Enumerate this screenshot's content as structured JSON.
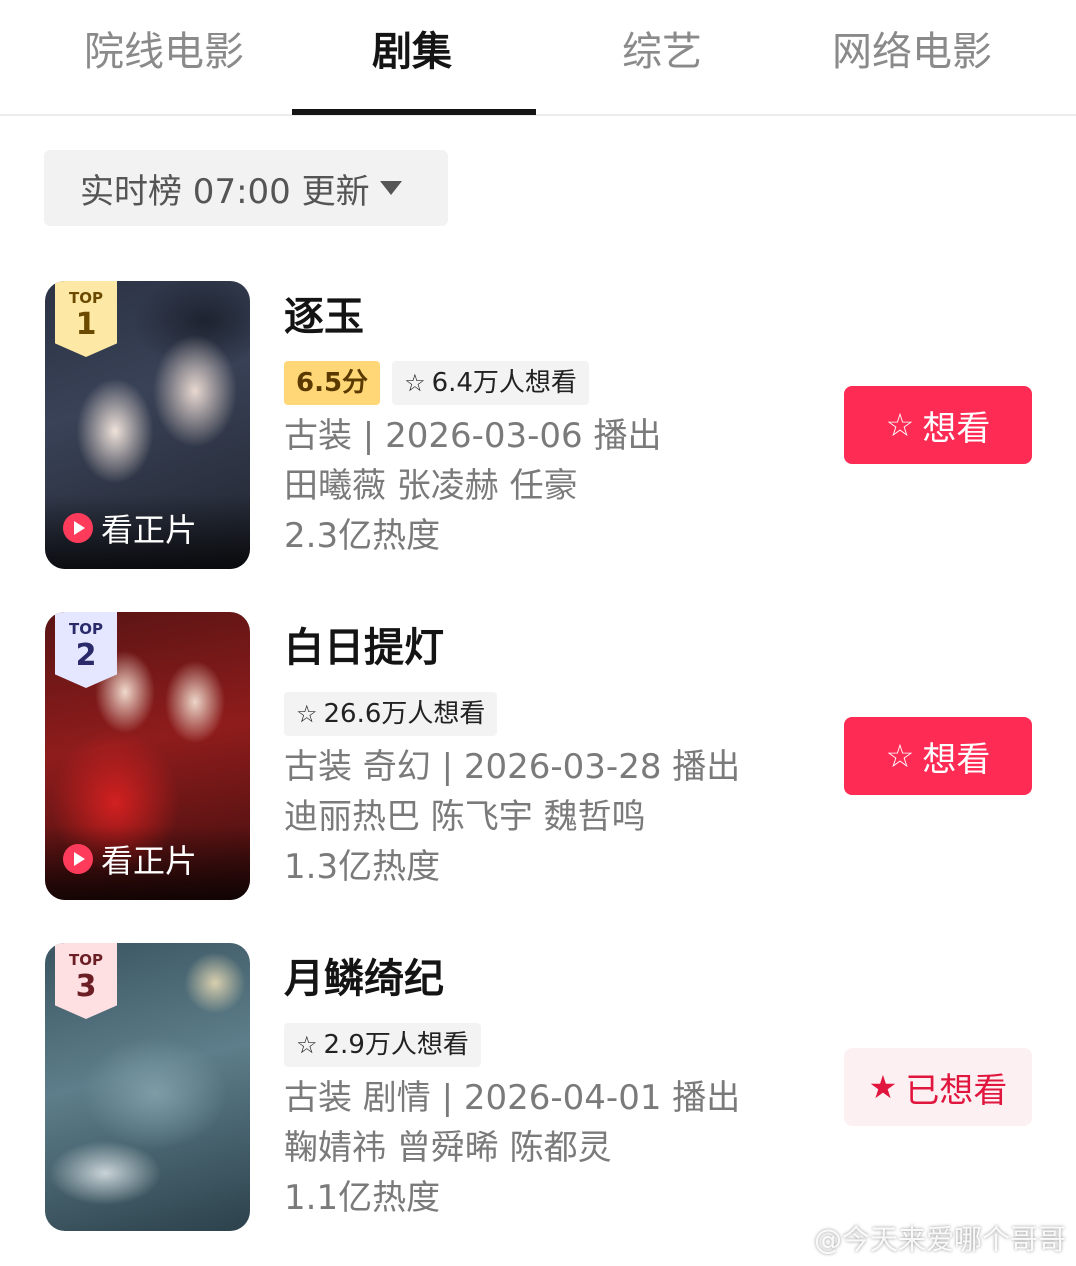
{
  "tabs": [
    {
      "label": "院线电影"
    },
    {
      "label": "剧集"
    },
    {
      "label": "综艺"
    },
    {
      "label": "网络电影"
    }
  ],
  "filter": {
    "label": "实时榜 07:00 更新"
  },
  "items": [
    {
      "badge_top": "TOP",
      "rank": "1",
      "watch_label": "看正片",
      "title": "逐玉",
      "score": "6.5分",
      "want_count": "6.4万人想看",
      "genre_date": "古装 | 2026-03-06 播出",
      "cast": "田曦薇 张凌赫 任豪",
      "heat": "2.3亿热度",
      "button": "想看"
    },
    {
      "badge_top": "TOP",
      "rank": "2",
      "watch_label": "看正片",
      "title": "白日提灯",
      "want_count": "26.6万人想看",
      "genre_date": "古装 奇幻 | 2026-03-28 播出",
      "cast": "迪丽热巴 陈飞宇 魏哲鸣",
      "heat": "1.3亿热度",
      "button": "想看"
    },
    {
      "badge_top": "TOP",
      "rank": "3",
      "title": "月鳞绮纪",
      "want_count": "2.9万人想看",
      "genre_date": "古装 剧情 | 2026-04-01 播出",
      "cast": "鞠婧祎 曾舜晞 陈都灵",
      "heat": "1.1亿热度",
      "button": "已想看"
    }
  ],
  "watermark": "@今天来爱哪个哥哥",
  "colors": {
    "accent": "#fe2c55",
    "score_bg": "#ffd776",
    "tag_bg": "#f3f3f3",
    "active_tab": "#141414"
  }
}
